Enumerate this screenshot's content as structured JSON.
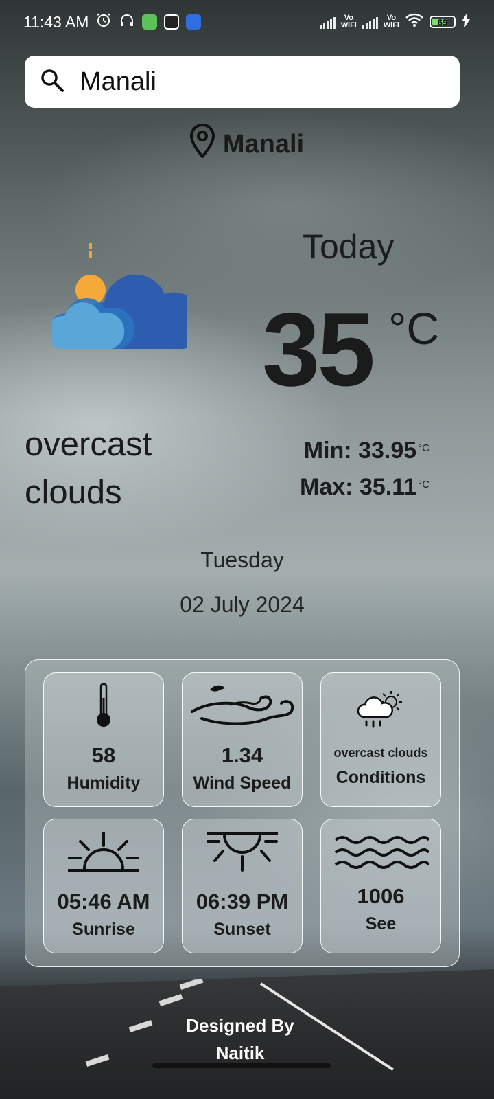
{
  "status_bar": {
    "time": "11:43 AM",
    "vo_wifi_1": "Vo\nWiFi",
    "vo_wifi_2": "Vo\nWiFi",
    "battery": "69",
    "icons": [
      "alarm-icon",
      "headphones-icon",
      "app-icon",
      "app-icon",
      "phone-icon",
      "signal-icon",
      "wifi-icon",
      "battery-icon",
      "charging-icon"
    ]
  },
  "search": {
    "value": "Manali",
    "icon": "search-icon"
  },
  "location": {
    "name": "Manali",
    "icon": "location-pin-icon"
  },
  "current": {
    "icon": "partly-cloudy-icon",
    "today_label": "Today",
    "temperature": "35",
    "unit": "°C",
    "description": "overcast clouds",
    "min_label": "Min: 33.95",
    "max_label": "Max: 35.11",
    "minmax_unit": "°C"
  },
  "date": {
    "day": "Tuesday",
    "full": "02 July 2024"
  },
  "details": [
    {
      "icon": "thermometer-icon",
      "value": "58",
      "label": "Humidity"
    },
    {
      "icon": "wind-icon",
      "value": "1.34",
      "label": "Wind Speed"
    },
    {
      "icon": "cloud-rain-sun-icon",
      "value": "overcast clouds",
      "label": "Conditions"
    },
    {
      "icon": "sunrise-icon",
      "value": "05:46 AM",
      "label": "Sunrise"
    },
    {
      "icon": "sunset-icon",
      "value": "06:39 PM",
      "label": "Sunset"
    },
    {
      "icon": "waves-icon",
      "value": "1006",
      "label": "See"
    }
  ],
  "footer": {
    "line1": "Designed By",
    "line2": "Naitik"
  }
}
